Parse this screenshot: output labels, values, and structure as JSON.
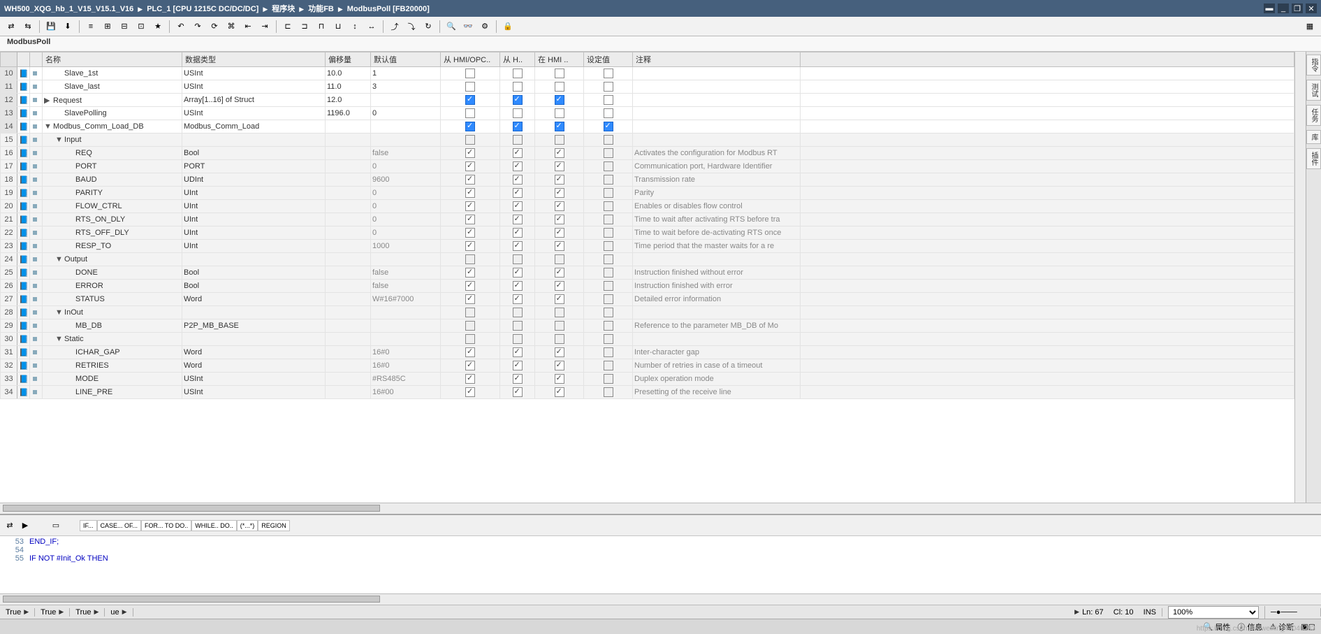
{
  "breadcrumb": [
    "WH500_XQG_hb_1_V15_V15.1_V16",
    "PLC_1 [CPU 1215C DC/DC/DC]",
    "程序块",
    "功能FB",
    "ModbusPoll [FB20000]"
  ],
  "panel_title": "ModbusPoll",
  "columns": {
    "name": "名称",
    "datatype": "数据类型",
    "offset": "偏移量",
    "default": "默认值",
    "hmi1": "从 HMI/OPC..",
    "hmi2": "从 H..",
    "hmi3": "在 HMI ..",
    "setval": "设定值",
    "comment": "注释"
  },
  "rows": [
    {
      "n": 10,
      "lvl": 1,
      "exp": "",
      "name": "Slave_1st",
      "type": "USInt",
      "off": "10.0",
      "def": "1",
      "c1": "off",
      "c2": "off",
      "c3": "off",
      "set": "off",
      "cm": "",
      "g": false
    },
    {
      "n": 11,
      "lvl": 1,
      "exp": "",
      "name": "Slave_last",
      "type": "USInt",
      "off": "11.0",
      "def": "3",
      "c1": "off",
      "c2": "off",
      "c3": "off",
      "set": "off",
      "cm": "",
      "g": false
    },
    {
      "n": 12,
      "lvl": 0,
      "exp": "▶",
      "name": "Request",
      "type": "Array[1..16] of Struct",
      "off": "12.0",
      "def": "",
      "c1": "blue",
      "c2": "blue",
      "c3": "blue",
      "set": "off",
      "cm": "",
      "g": false
    },
    {
      "n": 13,
      "lvl": 1,
      "exp": "",
      "name": "SlavePolling",
      "type": "USInt",
      "off": "1196.0",
      "def": "0",
      "c1": "off",
      "c2": "off",
      "c3": "off",
      "set": "off",
      "cm": "",
      "g": false
    },
    {
      "n": 14,
      "lvl": 0,
      "exp": "▼",
      "name": "Modbus_Comm_Load_DB",
      "type": "Modbus_Comm_Load",
      "off": "",
      "def": "",
      "c1": "blue",
      "c2": "blue",
      "c3": "blue",
      "set": "blue",
      "cm": "",
      "g": false
    },
    {
      "n": 15,
      "lvl": 1,
      "exp": "▼",
      "name": "Input",
      "type": "",
      "off": "",
      "def": "",
      "c1": "dim",
      "c2": "dim",
      "c3": "dim",
      "set": "dim",
      "cm": "",
      "g": true
    },
    {
      "n": 16,
      "lvl": 2,
      "exp": "",
      "name": "REQ",
      "type": "Bool",
      "off": "",
      "def": "false",
      "c1": "on",
      "c2": "on",
      "c3": "on",
      "set": "dim",
      "cm": "Activates the configuration for Modbus RT",
      "g": true
    },
    {
      "n": 17,
      "lvl": 2,
      "exp": "",
      "name": "PORT",
      "type": "PORT",
      "off": "",
      "def": "0",
      "c1": "on",
      "c2": "on",
      "c3": "on",
      "set": "dim",
      "cm": "Communication port, Hardware Identifier",
      "g": true
    },
    {
      "n": 18,
      "lvl": 2,
      "exp": "",
      "name": "BAUD",
      "type": "UDInt",
      "off": "",
      "def": "9600",
      "c1": "on",
      "c2": "on",
      "c3": "on",
      "set": "dim",
      "cm": "Transmission rate",
      "g": true
    },
    {
      "n": 19,
      "lvl": 2,
      "exp": "",
      "name": "PARITY",
      "type": "UInt",
      "off": "",
      "def": "0",
      "c1": "on",
      "c2": "on",
      "c3": "on",
      "set": "dim",
      "cm": "Parity",
      "g": true
    },
    {
      "n": 20,
      "lvl": 2,
      "exp": "",
      "name": "FLOW_CTRL",
      "type": "UInt",
      "off": "",
      "def": "0",
      "c1": "on",
      "c2": "on",
      "c3": "on",
      "set": "dim",
      "cm": "Enables or disables flow control",
      "g": true
    },
    {
      "n": 21,
      "lvl": 2,
      "exp": "",
      "name": "RTS_ON_DLY",
      "type": "UInt",
      "off": "",
      "def": "0",
      "c1": "on",
      "c2": "on",
      "c3": "on",
      "set": "dim",
      "cm": "Time to wait after activating RTS before tra",
      "g": true
    },
    {
      "n": 22,
      "lvl": 2,
      "exp": "",
      "name": "RTS_OFF_DLY",
      "type": "UInt",
      "off": "",
      "def": "0",
      "c1": "on",
      "c2": "on",
      "c3": "on",
      "set": "dim",
      "cm": "Time to wait before de-activating RTS once",
      "g": true
    },
    {
      "n": 23,
      "lvl": 2,
      "exp": "",
      "name": "RESP_TO",
      "type": "UInt",
      "off": "",
      "def": "1000",
      "c1": "on",
      "c2": "on",
      "c3": "on",
      "set": "dim",
      "cm": "Time period that the master waits for a re",
      "g": true
    },
    {
      "n": 24,
      "lvl": 1,
      "exp": "▼",
      "name": "Output",
      "type": "",
      "off": "",
      "def": "",
      "c1": "dim",
      "c2": "dim",
      "c3": "dim",
      "set": "dim",
      "cm": "",
      "g": true
    },
    {
      "n": 25,
      "lvl": 2,
      "exp": "",
      "name": "DONE",
      "type": "Bool",
      "off": "",
      "def": "false",
      "c1": "on",
      "c2": "on",
      "c3": "on",
      "set": "dim",
      "cm": "Instruction finished without error",
      "g": true
    },
    {
      "n": 26,
      "lvl": 2,
      "exp": "",
      "name": "ERROR",
      "type": "Bool",
      "off": "",
      "def": "false",
      "c1": "on",
      "c2": "on",
      "c3": "on",
      "set": "dim",
      "cm": "Instruction finished with error",
      "g": true
    },
    {
      "n": 27,
      "lvl": 2,
      "exp": "",
      "name": "STATUS",
      "type": "Word",
      "off": "",
      "def": "W#16#7000",
      "c1": "on",
      "c2": "on",
      "c3": "on",
      "set": "dim",
      "cm": "Detailed error information",
      "g": true
    },
    {
      "n": 28,
      "lvl": 1,
      "exp": "▼",
      "name": "InOut",
      "type": "",
      "off": "",
      "def": "",
      "c1": "dim",
      "c2": "dim",
      "c3": "dim",
      "set": "dim",
      "cm": "",
      "g": true
    },
    {
      "n": 29,
      "lvl": 2,
      "exp": "",
      "name": "MB_DB",
      "type": "P2P_MB_BASE",
      "off": "",
      "def": "",
      "c1": "dim",
      "c2": "dim",
      "c3": "dim",
      "set": "dim",
      "cm": "Reference to the parameter MB_DB of Mo",
      "g": true
    },
    {
      "n": 30,
      "lvl": 1,
      "exp": "▼",
      "name": "Static",
      "type": "",
      "off": "",
      "def": "",
      "c1": "dim",
      "c2": "dim",
      "c3": "dim",
      "set": "dim",
      "cm": "",
      "g": true
    },
    {
      "n": 31,
      "lvl": 2,
      "exp": "",
      "name": "ICHAR_GAP",
      "type": "Word",
      "off": "",
      "def": "16#0",
      "c1": "on",
      "c2": "on",
      "c3": "on",
      "set": "dim",
      "cm": "Inter-character gap",
      "g": true
    },
    {
      "n": 32,
      "lvl": 2,
      "exp": "",
      "name": "RETRIES",
      "type": "Word",
      "off": "",
      "def": "16#0",
      "c1": "on",
      "c2": "on",
      "c3": "on",
      "set": "dim",
      "cm": "Number of retries in case of a timeout",
      "g": true
    },
    {
      "n": 33,
      "lvl": 2,
      "exp": "",
      "name": "MODE",
      "type": "USInt",
      "off": "",
      "def": "#RS485C",
      "c1": "on",
      "c2": "on",
      "c3": "on",
      "set": "dim",
      "cm": "Duplex operation mode",
      "g": true
    },
    {
      "n": 34,
      "lvl": 2,
      "exp": "",
      "name": "LINE_PRE",
      "type": "USInt",
      "off": "",
      "def": "16#00",
      "c1": "on",
      "c2": "on",
      "c3": "on",
      "set": "dim",
      "cm": "Presetting of the receive line",
      "g": true
    }
  ],
  "code_tabs": [
    "IF...",
    "CASE... OF...",
    "FOR... TO DO..",
    "WHILE.. DO..",
    "(*...*)",
    "REGION"
  ],
  "code_lines": [
    {
      "ln": 53,
      "txt": "END_IF;",
      "kw": true
    },
    {
      "ln": 54,
      "txt": "",
      "kw": false
    },
    {
      "ln": 55,
      "txt": "IF NOT #Init_Ok THEN",
      "kw": true
    }
  ],
  "status": {
    "ln": "Ln: 67",
    "col": "Cl: 10",
    "mode": "INS",
    "zoom": "100%"
  },
  "extrabar": [
    "True",
    "True",
    "True",
    "ue"
  ],
  "footer": {
    "props": "属性",
    "info": "信息",
    "diag": "诊断"
  },
  "sidebar_tabs": [
    "指令",
    "测试",
    "任务",
    "库",
    "插件"
  ],
  "watermark": "https://blog.csdn.net/weixin_42040283"
}
